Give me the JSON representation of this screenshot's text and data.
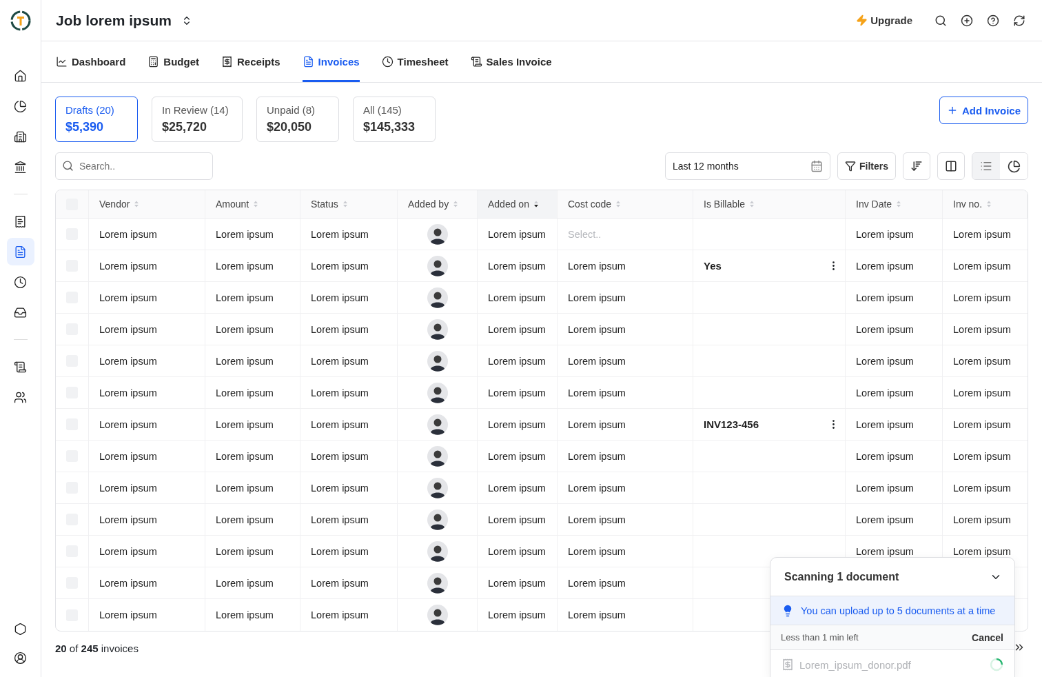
{
  "header": {
    "title": "Job lorem ipsum",
    "upgrade": "Upgrade"
  },
  "sidebar": {
    "groups": [
      [
        {
          "selected": false
        },
        {
          "selected": false
        },
        {
          "selected": false
        },
        {
          "selected": false
        }
      ],
      [
        {
          "selected": false
        },
        {
          "selected": true
        },
        {
          "selected": false
        },
        {
          "selected": false
        }
      ],
      [
        {
          "selected": false
        },
        {
          "selected": false
        }
      ]
    ],
    "bottom": [
      {
        "selected": false
      },
      {
        "selected": false
      }
    ]
  },
  "tabs": [
    {
      "label": "Dashboard",
      "selected": false
    },
    {
      "label": "Budget",
      "selected": false
    },
    {
      "label": "Receipts",
      "selected": false
    },
    {
      "label": "Invoices",
      "selected": true
    },
    {
      "label": "Timesheet",
      "selected": false
    },
    {
      "label": "Sales Invoice",
      "selected": false
    }
  ],
  "summary": [
    {
      "label": "Drafts (20)",
      "amount": "$5,390",
      "selected": true
    },
    {
      "label": "In Review (14)",
      "amount": "$25,720",
      "selected": false
    },
    {
      "label": "Unpaid (8)",
      "amount": "$20,050",
      "selected": false
    },
    {
      "label": "All (145)",
      "amount": "$145,333",
      "selected": false
    }
  ],
  "add_button": "Add Invoice",
  "toolbar": {
    "search_placeholder": "Search..",
    "date_range": "Last 12 months",
    "filters": "Filters",
    "views": [
      {
        "selected": true
      },
      {
        "selected": false
      }
    ]
  },
  "table": {
    "columns": [
      {
        "label": "Vendor",
        "sorted": false
      },
      {
        "label": "Amount",
        "sorted": false
      },
      {
        "label": "Status",
        "sorted": false
      },
      {
        "label": "Added by",
        "sorted": false
      },
      {
        "label": "Added on",
        "sorted": true
      },
      {
        "label": "Cost code",
        "sorted": false
      },
      {
        "label": "Is Billable",
        "sorted": false
      },
      {
        "label": "Inv Date",
        "sorted": false
      },
      {
        "label": "Inv no.",
        "sorted": false
      }
    ],
    "header_checked": false,
    "rows": [
      {
        "checked": false,
        "vendor": "Lorem ipsum",
        "amount": "Lorem ipsum",
        "status": "Lorem ipsum",
        "added_on": "Lorem ipsum",
        "cost_code_placeholder": "Select..",
        "actions": false,
        "inv_date": "Lorem ipsum",
        "inv_no": "Lorem ipsum"
      },
      {
        "checked": false,
        "vendor": "Lorem ipsum",
        "amount": "Lorem ipsum",
        "status": "Lorem ipsum",
        "added_on": "Lorem ipsum",
        "cost_code": "Lorem ipsum",
        "is_billable": "Yes",
        "actions": true,
        "inv_date": "Lorem ipsum",
        "inv_no": "Lorem ipsum"
      },
      {
        "checked": false,
        "vendor": "Lorem ipsum",
        "amount": "Lorem ipsum",
        "status": "Lorem ipsum",
        "added_on": "Lorem ipsum",
        "cost_code": "Lorem ipsum",
        "actions": false,
        "inv_date": "Lorem ipsum",
        "inv_no": "Lorem ipsum"
      },
      {
        "checked": false,
        "vendor": "Lorem ipsum",
        "amount": "Lorem ipsum",
        "status": "Lorem ipsum",
        "added_on": "Lorem ipsum",
        "cost_code": "Lorem ipsum",
        "actions": false,
        "inv_date": "Lorem ipsum",
        "inv_no": "Lorem ipsum"
      },
      {
        "checked": false,
        "vendor": "Lorem ipsum",
        "amount": "Lorem ipsum",
        "status": "Lorem ipsum",
        "added_on": "Lorem ipsum",
        "cost_code": "Lorem ipsum",
        "actions": false,
        "inv_date": "Lorem ipsum",
        "inv_no": "Lorem ipsum"
      },
      {
        "checked": false,
        "vendor": "Lorem ipsum",
        "amount": "Lorem ipsum",
        "status": "Lorem ipsum",
        "added_on": "Lorem ipsum",
        "cost_code": "Lorem ipsum",
        "actions": false,
        "inv_date": "Lorem ipsum",
        "inv_no": "Lorem ipsum"
      },
      {
        "checked": false,
        "vendor": "Lorem ipsum",
        "amount": "Lorem ipsum",
        "status": "Lorem ipsum",
        "added_on": "Lorem ipsum",
        "cost_code": "Lorem ipsum",
        "is_billable": "INV123-456",
        "actions": true,
        "inv_date": "Lorem ipsum",
        "inv_no": "Lorem ipsum"
      },
      {
        "checked": false,
        "vendor": "Lorem ipsum",
        "amount": "Lorem ipsum",
        "status": "Lorem ipsum",
        "added_on": "Lorem ipsum",
        "cost_code": "Lorem ipsum",
        "actions": false,
        "inv_date": "Lorem ipsum",
        "inv_no": "Lorem ipsum"
      },
      {
        "checked": false,
        "vendor": "Lorem ipsum",
        "amount": "Lorem ipsum",
        "status": "Lorem ipsum",
        "added_on": "Lorem ipsum",
        "cost_code": "Lorem ipsum",
        "actions": false,
        "inv_date": "Lorem ipsum",
        "inv_no": "Lorem ipsum"
      },
      {
        "checked": false,
        "vendor": "Lorem ipsum",
        "amount": "Lorem ipsum",
        "status": "Lorem ipsum",
        "added_on": "Lorem ipsum",
        "cost_code": "Lorem ipsum",
        "actions": false,
        "inv_date": "Lorem ipsum",
        "inv_no": "Lorem ipsum"
      },
      {
        "checked": false,
        "vendor": "Lorem ipsum",
        "amount": "Lorem ipsum",
        "status": "Lorem ipsum",
        "added_on": "Lorem ipsum",
        "cost_code": "Lorem ipsum",
        "actions": false,
        "inv_date": "Lorem ipsum",
        "inv_no": "Lorem ipsum"
      },
      {
        "checked": false,
        "vendor": "Lorem ipsum",
        "amount": "Lorem ipsum",
        "status": "Lorem ipsum",
        "added_on": "Lorem ipsum",
        "cost_code": "Lorem ipsum",
        "actions": false
      },
      {
        "checked": false,
        "vendor": "Lorem ipsum",
        "amount": "Lorem ipsum",
        "status": "Lorem ipsum",
        "added_on": "Lorem ipsum",
        "cost_code": "Lorem ipsum",
        "actions": false
      }
    ]
  },
  "footer": {
    "count": "**20** of **245** invoices"
  },
  "scan_popup": {
    "title": "Scanning 1 document",
    "expanded": true,
    "tip": "You can upload up to 5 documents at a time",
    "time_left": "Less than 1 min left",
    "cancel": "Cancel",
    "file": "Lorem_ipsum_donor.pdf"
  }
}
